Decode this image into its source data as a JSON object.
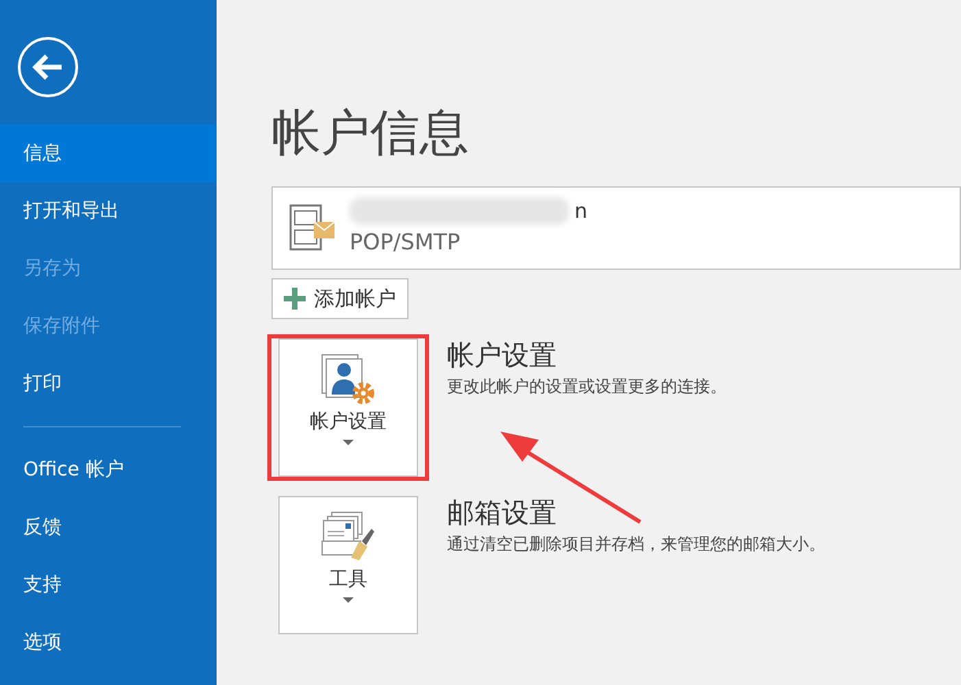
{
  "sidebar": {
    "items": [
      {
        "label": "信息",
        "selected": true,
        "disabled": false,
        "divider_after": false
      },
      {
        "label": "打开和导出",
        "selected": false,
        "disabled": false,
        "divider_after": false
      },
      {
        "label": "另存为",
        "selected": false,
        "disabled": true,
        "divider_after": false
      },
      {
        "label": "保存附件",
        "selected": false,
        "disabled": true,
        "divider_after": false
      },
      {
        "label": "打印",
        "selected": false,
        "disabled": false,
        "divider_after": true
      },
      {
        "label": "Office 帐户",
        "selected": false,
        "disabled": false,
        "divider_after": false
      },
      {
        "label": "反馈",
        "selected": false,
        "disabled": false,
        "divider_after": false
      },
      {
        "label": "支持",
        "selected": false,
        "disabled": false,
        "divider_after": false
      },
      {
        "label": "选项",
        "selected": false,
        "disabled": false,
        "divider_after": false
      }
    ]
  },
  "page_title": "帐户信息",
  "account": {
    "name": "n",
    "type": "POP/SMTP"
  },
  "add_account_button": "添加帐户",
  "sections": [
    {
      "kind": "account",
      "button_label": "帐户设置",
      "title": "帐户设置",
      "description": "更改此帐户的设置或设置更多的连接。",
      "highlighted": true
    },
    {
      "kind": "tools",
      "button_label": "工具",
      "title": "邮箱设置",
      "description": "通过清空已删除项目并存档，来管理您的邮箱大小。",
      "highlighted": false
    }
  ]
}
